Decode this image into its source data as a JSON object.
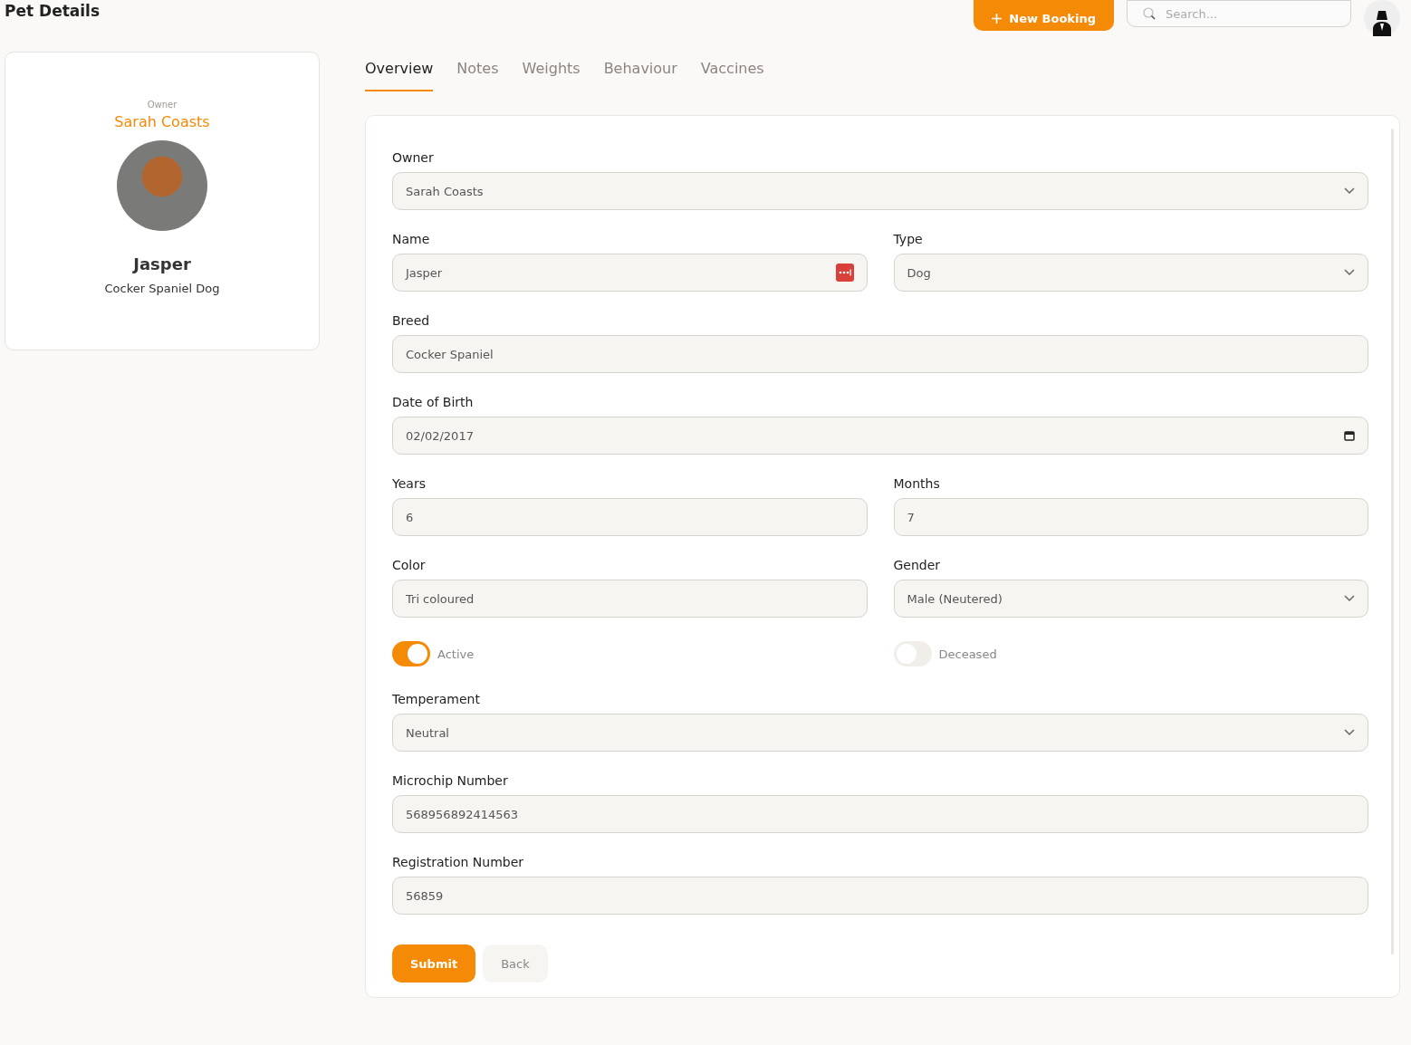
{
  "header": {
    "title": "Pet Details",
    "new_booking": "New Booking",
    "search": {
      "placeholder": "Search..."
    }
  },
  "profile": {
    "owner_label": "Owner",
    "owner_name": "Sarah Coasts",
    "pet_name": "Jasper",
    "description": "Cocker Spaniel Dog"
  },
  "tabs": [
    {
      "label": "Overview",
      "selected": true
    },
    {
      "label": "Notes",
      "selected": false
    },
    {
      "label": "Weights",
      "selected": false
    },
    {
      "label": "Behaviour",
      "selected": false
    },
    {
      "label": "Vaccines",
      "selected": false
    }
  ],
  "form": {
    "rows": [
      [
        {
          "label": "Owner",
          "value": "Sarah Coasts",
          "kind": "select"
        }
      ],
      [
        {
          "label": "Name",
          "value": "Jasper",
          "kind": "autofill"
        },
        {
          "label": "Type",
          "value": "Dog",
          "kind": "select"
        }
      ],
      [
        {
          "label": "Breed",
          "value": "Cocker Spaniel",
          "kind": "text"
        }
      ],
      [
        {
          "label": "Date of Birth",
          "value": "02/02/2017",
          "kind": "date"
        }
      ],
      [
        {
          "label": "Years",
          "value": "6",
          "kind": "text"
        },
        {
          "label": "Months",
          "value": "7",
          "kind": "text"
        }
      ],
      [
        {
          "label": "Color",
          "value": "Tri coloured",
          "kind": "text"
        },
        {
          "label": "Gender",
          "value": "Male (Neutered)",
          "kind": "select"
        }
      ]
    ],
    "toggles": [
      {
        "label": "Active",
        "on": true
      },
      {
        "label": "Deceased",
        "on": false
      }
    ],
    "rows_after": [
      [
        {
          "label": "Temperament",
          "value": "Neutral",
          "kind": "select"
        }
      ],
      [
        {
          "label": "Microchip Number",
          "value": "568956892414563",
          "kind": "text"
        }
      ],
      [
        {
          "label": "Registration Number",
          "value": "56859",
          "kind": "text"
        }
      ]
    ],
    "buttons": {
      "submit": "Submit",
      "back": "Back"
    }
  }
}
